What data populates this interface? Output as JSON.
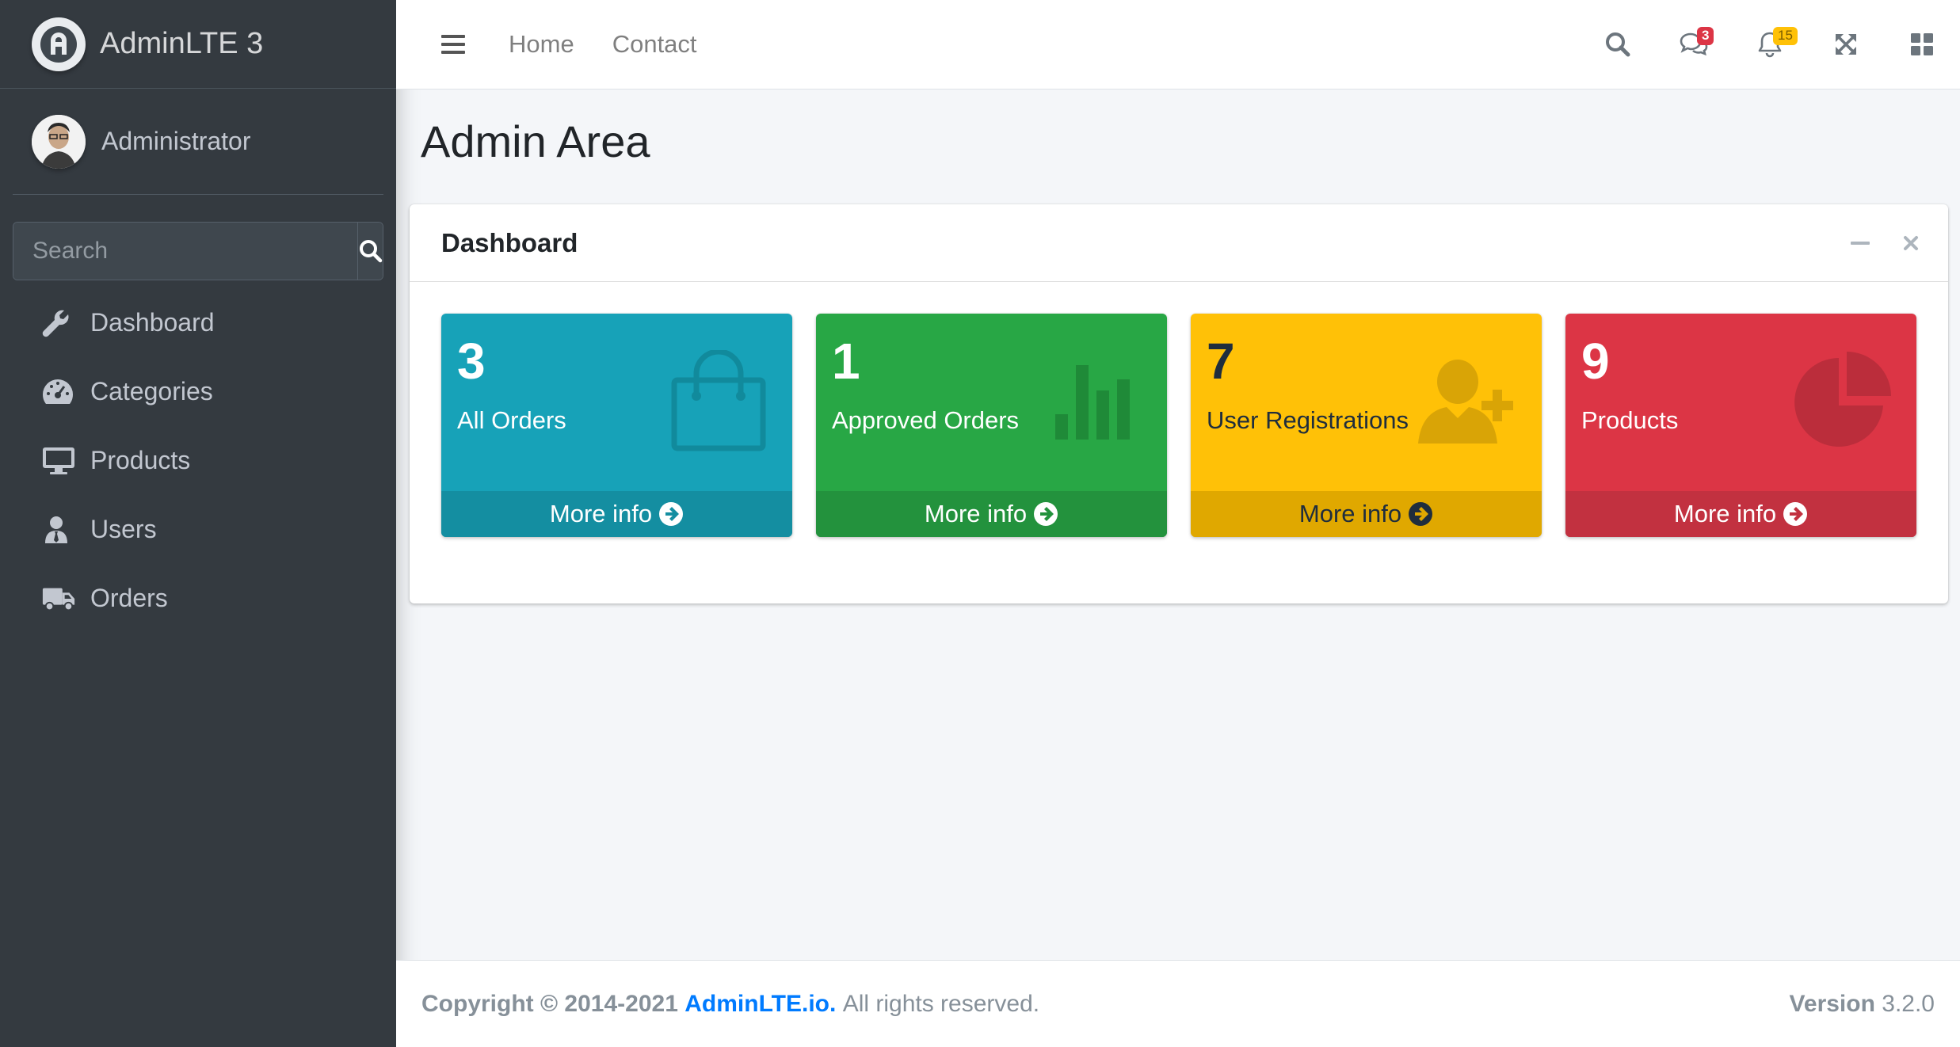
{
  "brand": {
    "name": "AdminLTE 3"
  },
  "user": {
    "name": "Administrator"
  },
  "search": {
    "placeholder": "Search"
  },
  "sidebar": {
    "items": [
      {
        "label": "Dashboard",
        "icon": "wrench-icon"
      },
      {
        "label": "Categories",
        "icon": "tachometer-icon"
      },
      {
        "label": "Products",
        "icon": "desktop-icon"
      },
      {
        "label": "Users",
        "icon": "user-tie-icon"
      },
      {
        "label": "Orders",
        "icon": "truck-icon"
      }
    ]
  },
  "topbar": {
    "links": [
      "Home",
      "Contact"
    ],
    "messages_badge": "3",
    "notifications_badge": "15"
  },
  "page": {
    "title": "Admin Area"
  },
  "card": {
    "title": "Dashboard"
  },
  "boxes": [
    {
      "number": "3",
      "label": "All Orders",
      "footer": "More info",
      "color": "#17a2b8",
      "icon": "shopping-bag-icon"
    },
    {
      "number": "1",
      "label": "Approved Orders",
      "footer": "More info",
      "color": "#28a745",
      "icon": "bar-chart-icon"
    },
    {
      "number": "7",
      "label": "User Registrations",
      "footer": "More info",
      "color": "#ffc107",
      "icon": "user-plus-icon"
    },
    {
      "number": "9",
      "label": "Products",
      "footer": "More info",
      "color": "#dc3545",
      "icon": "pie-chart-icon"
    }
  ],
  "footer": {
    "copyright": "Copyright © 2014-2021",
    "link": "AdminLTE.io.",
    "rights": "All rights reserved.",
    "version_label": "Version",
    "version": "3.2.0"
  }
}
